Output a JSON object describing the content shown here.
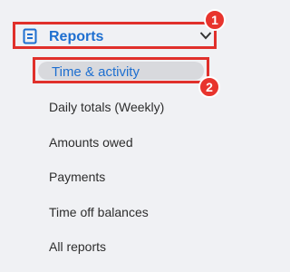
{
  "reports_section": {
    "label": "Reports",
    "icon": "document-icon",
    "expand_icon": "chevron-down-icon",
    "accent_color": "#1e6fd0"
  },
  "annotations": {
    "badge_1": "1",
    "badge_2": "2",
    "highlight_color": "#e0302b"
  },
  "menu": {
    "active": {
      "label": "Time & activity"
    },
    "items": [
      {
        "label": "Daily totals (Weekly)"
      },
      {
        "label": "Amounts owed"
      },
      {
        "label": "Payments"
      },
      {
        "label": "Time off balances"
      },
      {
        "label": "All reports"
      }
    ]
  }
}
